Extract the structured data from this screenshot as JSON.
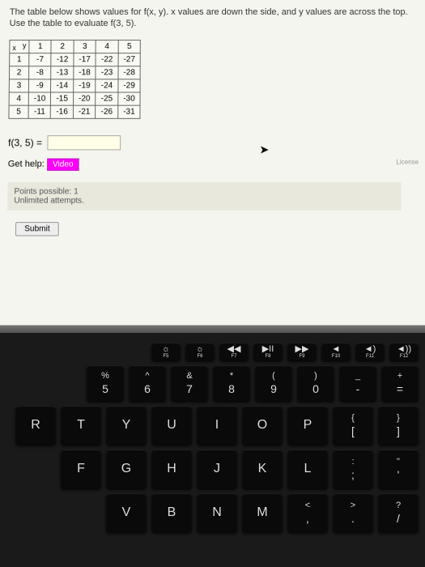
{
  "problem": {
    "text": "The table below shows values for f(x, y). x values are down the side, and y values are across the top. Use the table to evaluate f(3, 5)."
  },
  "table": {
    "corner_y": "y",
    "corner_x": "x",
    "y_headers": [
      "1",
      "2",
      "3",
      "4",
      "5"
    ],
    "rows": [
      {
        "x": "1",
        "cells": [
          "-7",
          "-12",
          "-17",
          "-22",
          "-27"
        ]
      },
      {
        "x": "2",
        "cells": [
          "-8",
          "-13",
          "-18",
          "-23",
          "-28"
        ]
      },
      {
        "x": "3",
        "cells": [
          "-9",
          "-14",
          "-19",
          "-24",
          "-29"
        ]
      },
      {
        "x": "4",
        "cells": [
          "-10",
          "-15",
          "-20",
          "-25",
          "-30"
        ]
      },
      {
        "x": "5",
        "cells": [
          "-11",
          "-16",
          "-21",
          "-26",
          "-31"
        ]
      }
    ]
  },
  "equation": {
    "lhs": "f(3, 5) ="
  },
  "help": {
    "label": "Get help:",
    "video": "Video"
  },
  "license": "License",
  "points": {
    "line1": "Points possible: 1",
    "line2": "Unlimited attempts."
  },
  "submit": "Submit",
  "keyboard": {
    "frow": [
      {
        "icon": "☼",
        "sub": "F5"
      },
      {
        "icon": "☼",
        "sub": "F6"
      },
      {
        "icon": "◀◀",
        "sub": "F7"
      },
      {
        "icon": "▶II",
        "sub": "F8"
      },
      {
        "icon": "▶▶",
        "sub": "F9"
      },
      {
        "icon": "◄",
        "sub": "F10"
      },
      {
        "icon": "◄)",
        "sub": "F11"
      },
      {
        "icon": "◄))",
        "sub": "F12"
      }
    ],
    "numrow": [
      {
        "top": "%",
        "bot": "5"
      },
      {
        "top": "^",
        "bot": "6"
      },
      {
        "top": "&",
        "bot": "7"
      },
      {
        "top": "*",
        "bot": "8"
      },
      {
        "top": "(",
        "bot": "9"
      },
      {
        "top": ")",
        "bot": "0"
      },
      {
        "top": "_",
        "bot": "-"
      },
      {
        "top": "+",
        "bot": "="
      }
    ],
    "row1": [
      "R",
      "T",
      "Y",
      "U",
      "I",
      "O",
      "P"
    ],
    "row1_end": {
      "top": "{",
      "bot": "["
    },
    "row1_end2": {
      "top": "}",
      "bot": "]"
    },
    "row2": [
      "F",
      "G",
      "H",
      "J",
      "K",
      "L"
    ],
    "row2_end": {
      "top": ":",
      "bot": ";"
    },
    "row2_end2": {
      "top": "\"",
      "bot": "'"
    },
    "row3": [
      "V",
      "B",
      "N",
      "M"
    ],
    "row3_end": {
      "top": "<",
      "bot": ","
    },
    "row3_end2": {
      "top": ">",
      "bot": "."
    },
    "row3_end3": {
      "top": "?",
      "bot": "/"
    }
  }
}
